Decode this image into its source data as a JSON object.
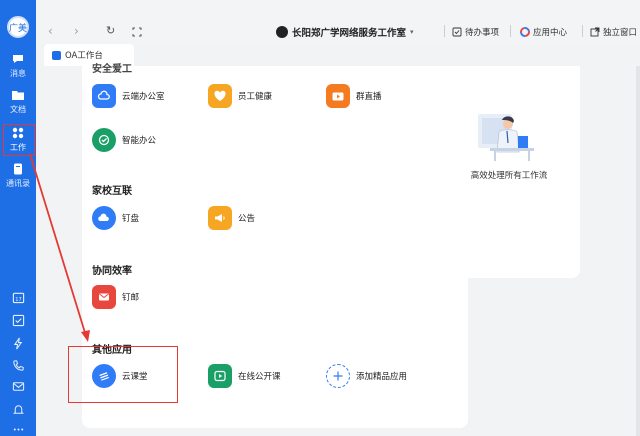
{
  "rail": {
    "avatar_text": "广美",
    "items": [
      {
        "label": "消息",
        "icon": "chat-icon"
      },
      {
        "label": "文档",
        "icon": "folder-icon"
      },
      {
        "label": "工作",
        "icon": "grid-icon"
      },
      {
        "label": "通讯录",
        "icon": "contacts-icon"
      }
    ],
    "bottom_icons": [
      "calendar-icon",
      "todo-check-icon",
      "lightning-icon",
      "phone-icon",
      "mail-icon",
      "bell-icon",
      "more-icon"
    ],
    "calendar_day": "17"
  },
  "topbar": {
    "back": "‹",
    "forward": "›",
    "refresh": "↻",
    "title": "长阳郑广学网络服务工作室",
    "actions": {
      "todo": "待办事项",
      "app_center": "应用中心",
      "standalone": "独立窗口"
    }
  },
  "tab": {
    "label": "OA工作台"
  },
  "sections": [
    {
      "title": "安全爱工",
      "apps": [
        {
          "label": "云端办公室",
          "color": "#2f7cf6"
        },
        {
          "label": "员工健康",
          "color": "#f6a623"
        },
        {
          "label": "群直播",
          "color": "#f47b20"
        },
        {
          "label": "智能办公",
          "color": "#1aa067"
        }
      ]
    },
    {
      "title": "家校互联",
      "apps": [
        {
          "label": "钉盘",
          "color": "#2f7cf6"
        },
        {
          "label": "公告",
          "color": "#f6a623"
        }
      ]
    },
    {
      "title": "协同效率",
      "apps": [
        {
          "label": "钉邮",
          "color": "#e8473e"
        }
      ]
    },
    {
      "title": "其他应用",
      "apps": [
        {
          "label": "云课堂",
          "color": "#2f7cf6"
        },
        {
          "label": "在线公开课",
          "color": "#1aa067"
        },
        {
          "label": "添加精品应用",
          "color": "#2f7cf6"
        }
      ]
    }
  ],
  "right_card": {
    "caption": "高效处理所有工作流"
  },
  "colors": {
    "accent": "#1e6fe6",
    "annotation": "#e53935"
  }
}
